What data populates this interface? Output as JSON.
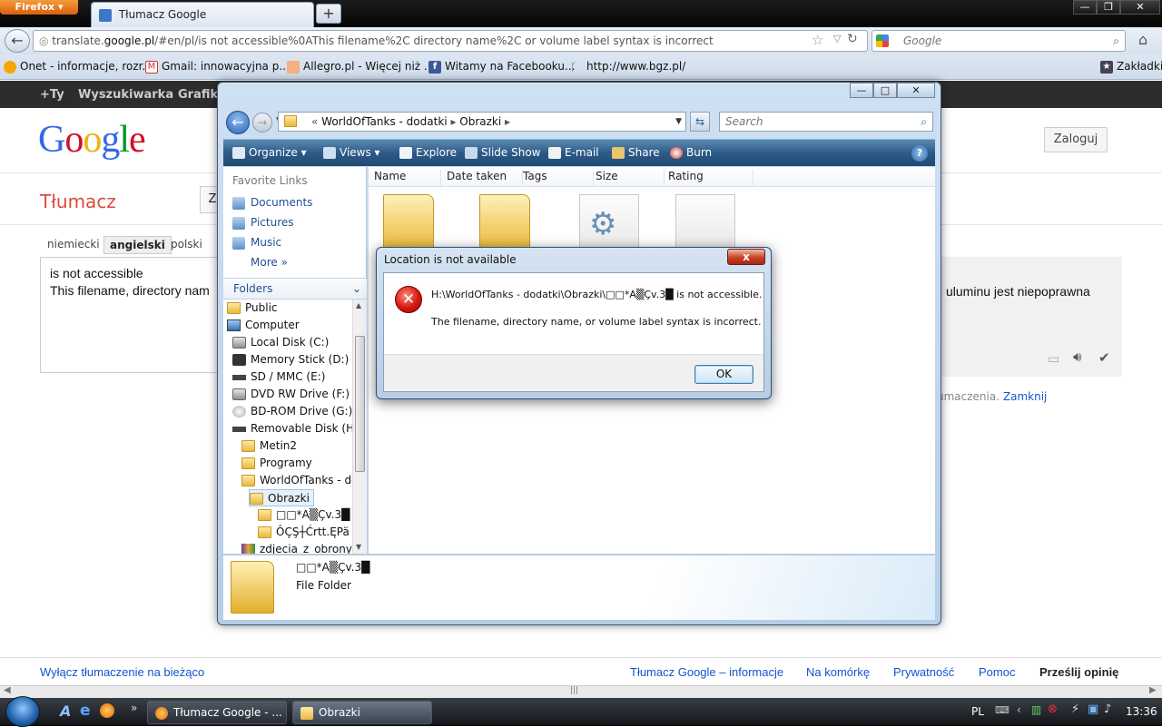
{
  "firefox": {
    "menu_button": "Firefox",
    "tab_title": "Tłumacz Google",
    "new_tab": "+",
    "url_host_pre": "translate.",
    "url_host": "google.pl",
    "url_path": "/#en/pl/is not accessible%0AThis filename%2C directory name%2C or volume label syntax is incorrect",
    "search_placeholder": "Google",
    "bookmarks": [
      "Onet - informacje, rozr...",
      "Gmail: innowacyjna p...",
      "Allegro.pl - Więcej niż ...",
      "Witamy na Facebooku...",
      "http://www.bgz.pl/"
    ],
    "bookmarks_menu": "Zakładki"
  },
  "google": {
    "bar": [
      "+Ty",
      "Wyszukiwarka",
      "Grafika"
    ],
    "logo": "Google",
    "signin": "Zaloguj",
    "app_title": "Tłumacz",
    "from_button": "Z",
    "langs": [
      "niemiecki",
      "angielski",
      "polski"
    ],
    "source_line1": "is not accessible",
    "source_line2": "This filename, directory nam",
    "result_tail": "uluminu jest niepoprawna",
    "hint": "umaczenia.",
    "hint_link": "Zamknij",
    "footer": {
      "instant_off": "Wyłącz tłumaczenie na bieżąco",
      "about": "Tłumacz Google – informacje",
      "mobile": "Na komórkę",
      "privacy": "Prywatność",
      "help": "Pomoc",
      "feedback": "Prześlij opinię"
    }
  },
  "explorer": {
    "breadcrumb": [
      "WorldOfTanks - dodatki",
      "Obrazki"
    ],
    "search_placeholder": "Search",
    "toolbar": [
      "Organize",
      "Views",
      "Explore",
      "Slide Show",
      "E-mail",
      "Share",
      "Burn"
    ],
    "favorite_links_title": "Favorite Links",
    "favorite_links": [
      "Documents",
      "Pictures",
      "Music",
      "More"
    ],
    "folders_title": "Folders",
    "tree": [
      "Public",
      "Computer",
      "Local Disk (C:)",
      "Memory Stick (D:)",
      "SD / MMC (E:)",
      "DVD RW Drive (F:)",
      "BD-ROM Drive (G:) C",
      "Removable Disk (H:)",
      "Metin2",
      "Programy",
      "WorldOfTanks - dod",
      "Obrazki",
      "□□*A▒Çv.3█",
      "ÔÇŞ┼Ćrtt.ĘPä",
      "zdjecia_z_obrony"
    ],
    "columns": [
      "Name",
      "Date taken",
      "Tags",
      "Size",
      "Rating"
    ],
    "details_name": "□□*A▒Çv.3█",
    "details_type": "File Folder"
  },
  "dialog": {
    "title": "Location is not available",
    "message1": "H:\\WorldOfTanks - dodatki\\Obrazki\\□□*A▒Çv.3█  is not accessible.",
    "message2": "The filename, directory name, or volume label syntax is incorrect.",
    "ok": "OK",
    "close": "x"
  },
  "taskbar": {
    "items": [
      "Tłumacz Google - ...",
      "Obrazki"
    ],
    "language": "PL",
    "clock": "13:36"
  }
}
